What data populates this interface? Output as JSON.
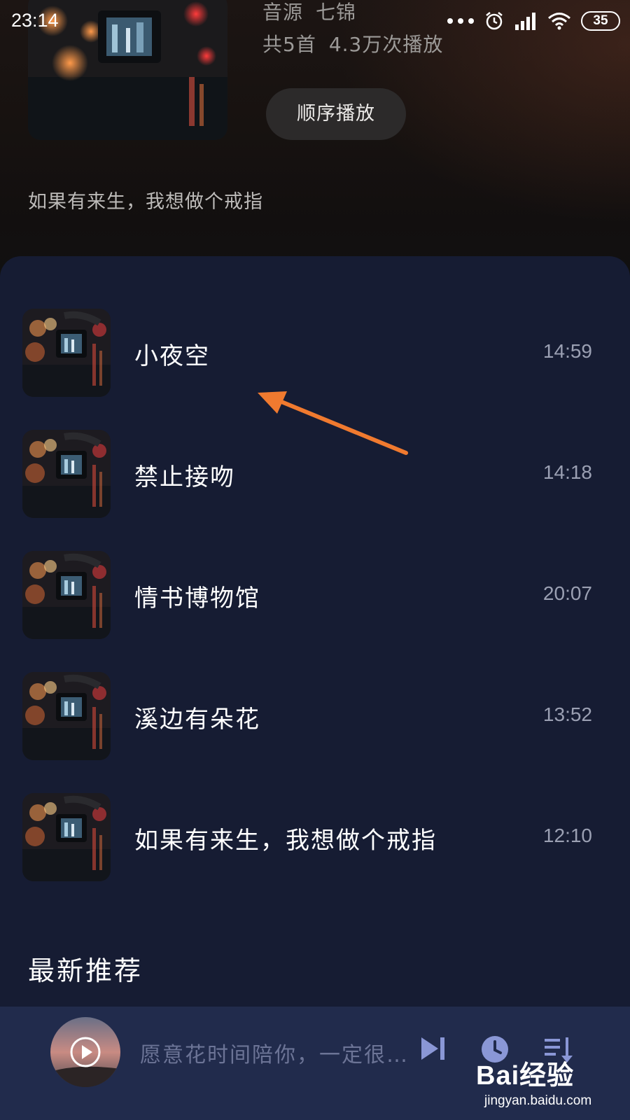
{
  "status_bar": {
    "time": "23:14",
    "battery": "35"
  },
  "album": {
    "source_label": "音源",
    "source_name": "七锦",
    "count": "共5首",
    "plays": "4.3万次播放",
    "play_order_label": "顺序播放",
    "description": "如果有来生，我想做个戒指"
  },
  "tracks": [
    {
      "title": "小夜空",
      "duration": "14:59"
    },
    {
      "title": "禁止接吻",
      "duration": "14:18"
    },
    {
      "title": "情书博物馆",
      "duration": "20:07"
    },
    {
      "title": "溪边有朵花",
      "duration": "13:52"
    },
    {
      "title": "如果有来生，我想做个戒指",
      "duration": "12:10"
    }
  ],
  "section_title": "最新推荐",
  "player": {
    "now_playing": "愿意花时间陪你，一定很…"
  },
  "watermark": {
    "logo": "Bai经验",
    "url": "jingyan.baidu.com"
  },
  "colors": {
    "panel_bg": "#161c33",
    "player_bg": "#212b4c",
    "arrow": "#f07a2f",
    "player_icon": "#8a97d6"
  }
}
